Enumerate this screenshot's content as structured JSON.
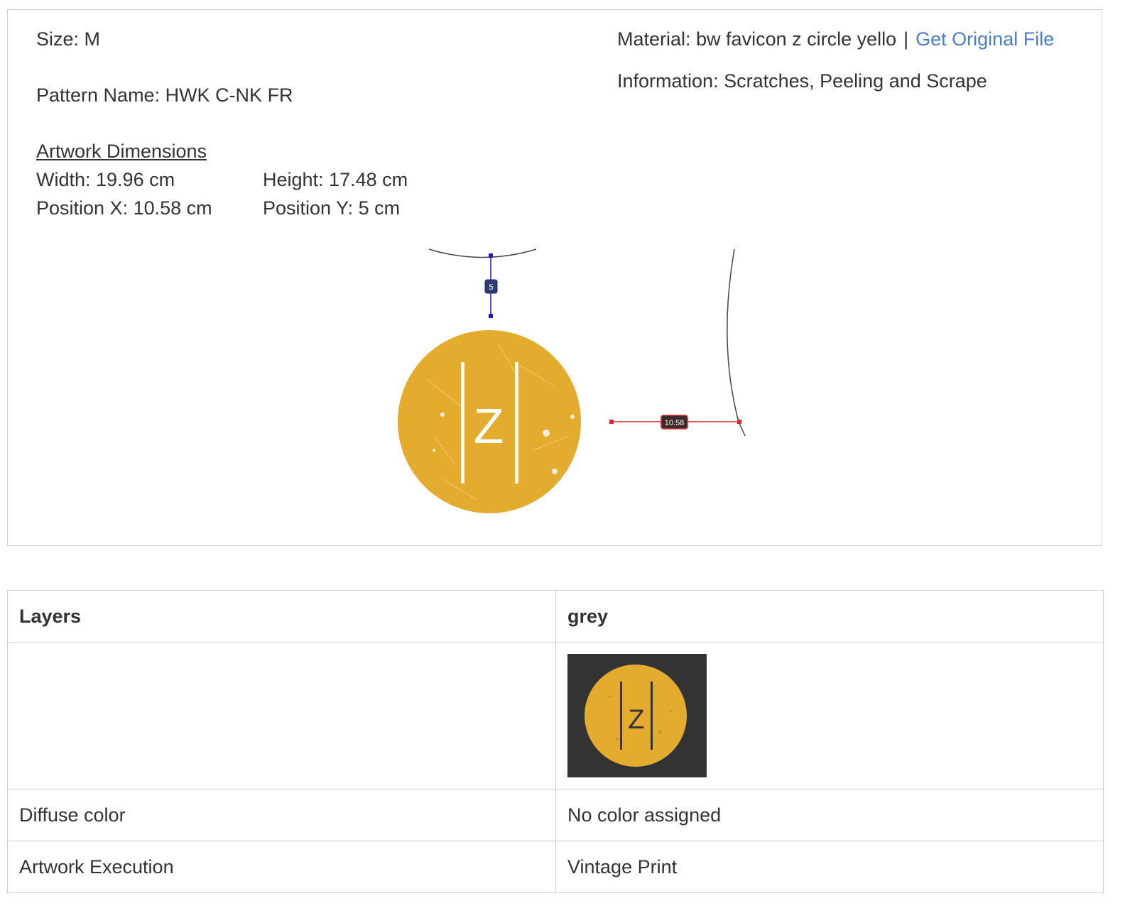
{
  "details": {
    "size": "Size: M",
    "pattern_name": "Pattern Name: HWK C-NK FR",
    "material": "Material: bw favicon z circle yello",
    "separator": "|",
    "get_original_file": "Get Original File",
    "information": "Information: Scratches, Peeling and Scrape"
  },
  "dimensions": {
    "heading": "Artwork Dimensions",
    "width": "Width: 19.96 cm",
    "height": "Height: 17.48 cm",
    "position_x": "Position X: 10.58 cm",
    "position_y": "Position Y: 5 cm"
  },
  "preview": {
    "top_offset_label": "5",
    "side_offset_label": "10.58",
    "logo_letter": "Z"
  },
  "table": {
    "header_left": "Layers",
    "header_right": "grey",
    "rows": [
      {
        "label": "Diffuse color",
        "value": "No color assigned"
      },
      {
        "label": "Artwork Execution",
        "value": "Vintage Print"
      }
    ]
  },
  "colors": {
    "logo_yellow": "#e3ac2f",
    "thumb_background": "#333333",
    "link_blue": "#4a7cc9",
    "guide_blue": "#1c1cb0",
    "guide_red": "#d62d2d"
  }
}
